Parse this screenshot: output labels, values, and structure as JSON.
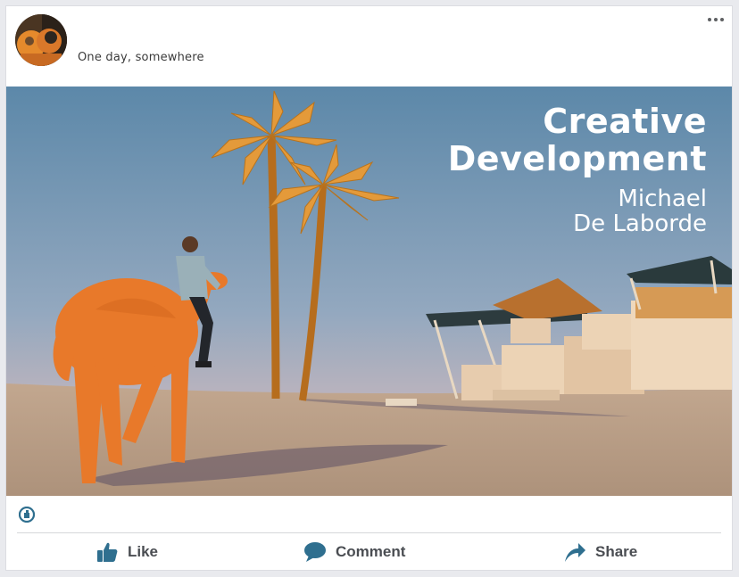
{
  "post": {
    "caption": "One day, somewhere",
    "more_icon": "more-dots-icon",
    "avatar_icon": "profile-avatar"
  },
  "image": {
    "title_line1": "Creative",
    "title_line2": "Development",
    "author_line1": "Michael",
    "author_line2": "De Laborde"
  },
  "reactions": {
    "icon": "like-reaction-icon"
  },
  "actions": {
    "like_label": "Like",
    "comment_label": "Comment",
    "share_label": "Share"
  },
  "colors": {
    "accent": "#2f6f8f",
    "sky_top": "#5f89aa",
    "sand": "#b49a84",
    "camel": "#e8792a"
  }
}
